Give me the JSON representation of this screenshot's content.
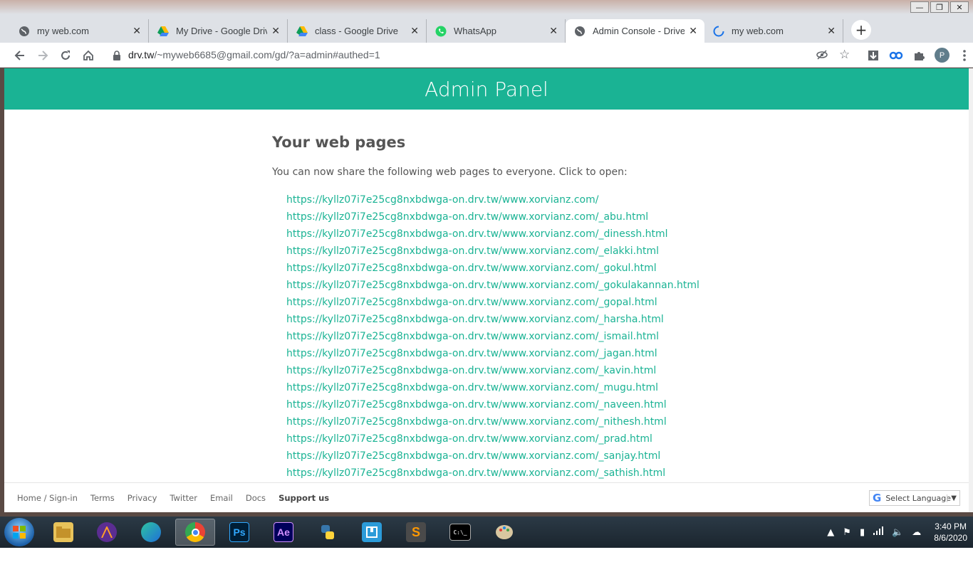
{
  "browser": {
    "tabs": [
      {
        "label": "my web.com",
        "icon": "globe-icon",
        "active": false
      },
      {
        "label": "My Drive - Google Drive",
        "icon": "google-drive-icon",
        "active": false
      },
      {
        "label": "class - Google Drive",
        "icon": "google-drive-icon",
        "active": false
      },
      {
        "label": "WhatsApp",
        "icon": "whatsapp-icon",
        "active": false
      },
      {
        "label": "Admin Console - DriveToWeb",
        "icon": "globe-icon",
        "active": true
      },
      {
        "label": "my web.com",
        "icon": "loading-spinner-icon",
        "active": false
      }
    ],
    "close_glyph": "✕",
    "new_tab_glyph": "+",
    "url_host": "drv.tw",
    "url_path": "/~myweb6685@gmail.com/gd/?a=admin#authed=1",
    "profile_initial": "P"
  },
  "page": {
    "banner_title": "Admin Panel",
    "heading": "Your web pages",
    "intro": "You can now share the following web pages to everyone. Click to open:",
    "links": [
      "https://kyllz07i7e25cg8nxbdwga-on.drv.tw/www.xorvianz.com/",
      "https://kyllz07i7e25cg8nxbdwga-on.drv.tw/www.xorvianz.com/_abu.html",
      "https://kyllz07i7e25cg8nxbdwga-on.drv.tw/www.xorvianz.com/_dinessh.html",
      "https://kyllz07i7e25cg8nxbdwga-on.drv.tw/www.xorvianz.com/_elakki.html",
      "https://kyllz07i7e25cg8nxbdwga-on.drv.tw/www.xorvianz.com/_gokul.html",
      "https://kyllz07i7e25cg8nxbdwga-on.drv.tw/www.xorvianz.com/_gokulakannan.html",
      "https://kyllz07i7e25cg8nxbdwga-on.drv.tw/www.xorvianz.com/_gopal.html",
      "https://kyllz07i7e25cg8nxbdwga-on.drv.tw/www.xorvianz.com/_harsha.html",
      "https://kyllz07i7e25cg8nxbdwga-on.drv.tw/www.xorvianz.com/_ismail.html",
      "https://kyllz07i7e25cg8nxbdwga-on.drv.tw/www.xorvianz.com/_jagan.html",
      "https://kyllz07i7e25cg8nxbdwga-on.drv.tw/www.xorvianz.com/_kavin.html",
      "https://kyllz07i7e25cg8nxbdwga-on.drv.tw/www.xorvianz.com/_mugu.html",
      "https://kyllz07i7e25cg8nxbdwga-on.drv.tw/www.xorvianz.com/_naveen.html",
      "https://kyllz07i7e25cg8nxbdwga-on.drv.tw/www.xorvianz.com/_nithesh.html",
      "https://kyllz07i7e25cg8nxbdwga-on.drv.tw/www.xorvianz.com/_prad.html",
      "https://kyllz07i7e25cg8nxbdwga-on.drv.tw/www.xorvianz.com/_sanjay.html",
      "https://kyllz07i7e25cg8nxbdwga-on.drv.tw/www.xorvianz.com/_sathish.html"
    ],
    "footer_links": [
      "Home / Sign-in",
      "Terms",
      "Privacy",
      "Twitter",
      "Email",
      "Docs",
      "Support us"
    ],
    "language_select": "Select Language",
    "accent_color": "#1ab394"
  },
  "taskbar": {
    "apps": [
      "file-explorer-icon",
      "affinity-icon",
      "edge-icon",
      "chrome-icon",
      "photoshop-icon",
      "after-effects-icon",
      "python-icon",
      "app-icon",
      "sublime-text-icon",
      "terminal-icon",
      "paint-icon"
    ],
    "ps_label": "Ps",
    "ae_label": "Ae",
    "time": "3:40 PM",
    "date": "8/6/2020"
  }
}
